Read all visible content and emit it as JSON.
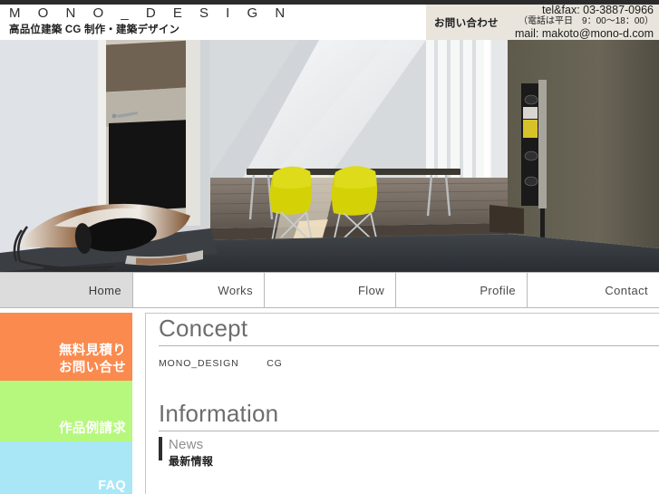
{
  "header": {
    "logo": "M O N O _ D E S I G N",
    "tagline": "高品位建築 CG 制作・建築デザイン",
    "contact": {
      "label": "お問い合わせ",
      "tel": "tel&fax:  03-3887-0966",
      "hours": "（電話は平日　9：00〜18：00）",
      "mail": "mail: makoto@mono-d.com"
    }
  },
  "hero": {
    "alt": "architectural-cg-interior-render"
  },
  "nav": {
    "items": [
      {
        "label": "Home",
        "active": true
      },
      {
        "label": "Works",
        "active": false
      },
      {
        "label": "Flow",
        "active": false
      },
      {
        "label": "Profile",
        "active": false
      },
      {
        "label": "Contact",
        "active": false
      }
    ]
  },
  "sidebar": {
    "blocks": [
      {
        "label": "無料見積り\nお問い合せ",
        "color": "#fb8a4e"
      },
      {
        "label": "作品例請求",
        "color": "#b6f87d"
      },
      {
        "label": "FAQ",
        "color": "#a9e7f7"
      }
    ]
  },
  "main": {
    "concept": {
      "heading": "Concept",
      "body": "MONO_DESIGN        CG"
    },
    "information": {
      "heading": "Information",
      "news": {
        "en": "News",
        "ja": "最新情報"
      }
    }
  },
  "colors": {
    "accent_orange": "#fb8a4e",
    "accent_green": "#b6f87d",
    "accent_blue": "#a9e7f7",
    "header_beige": "#e9e5dd",
    "nav_active": "#dcdcdc"
  }
}
